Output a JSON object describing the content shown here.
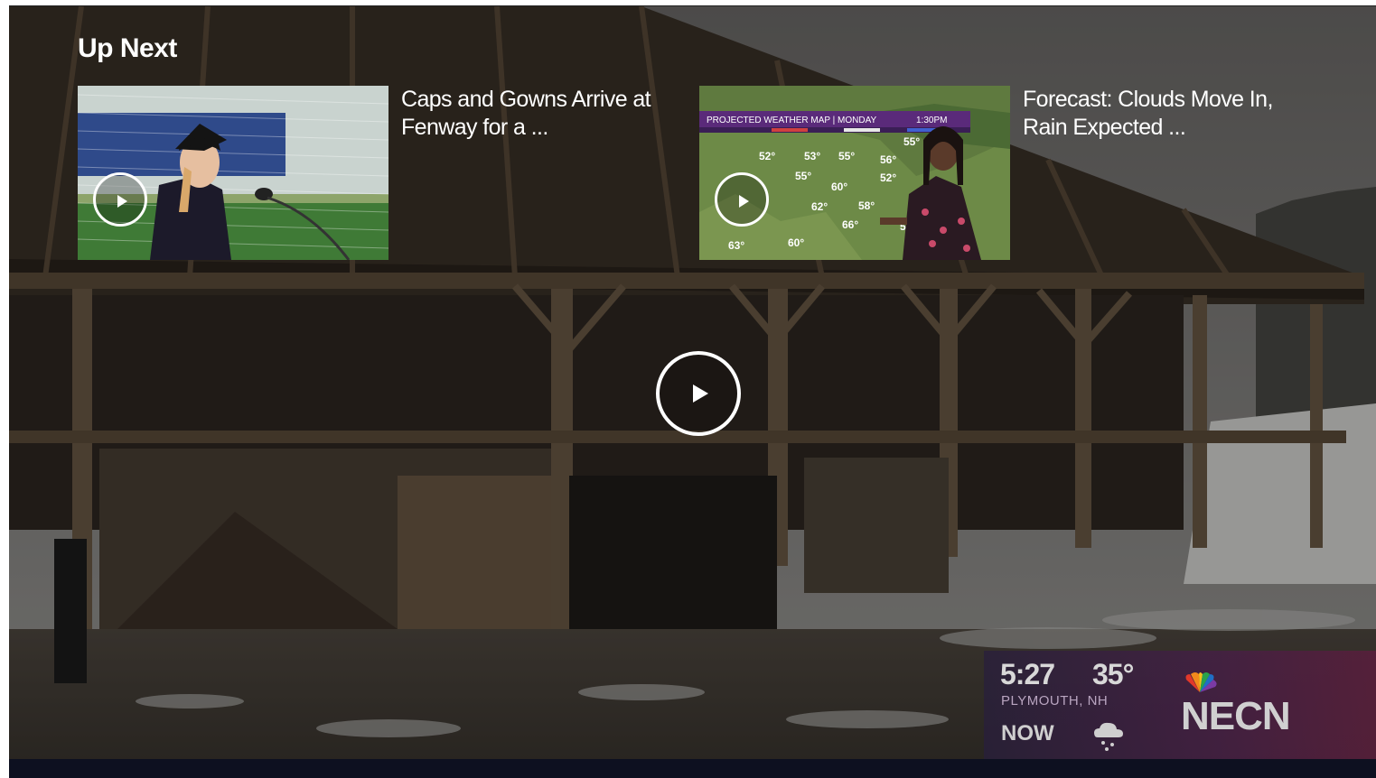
{
  "up_next": {
    "heading": "Up Next",
    "items": [
      {
        "title": "Caps and Gowns Arrive at Fenway for a ...",
        "thumbnail": "graduation-speaker-thumbnail"
      },
      {
        "title": "Forecast: Clouds Move In, Rain Expected ...",
        "thumbnail": "weather-map-thumbnail",
        "map_header": "PROJECTED WEATHER MAP | MONDAY",
        "map_time": "1:30PM",
        "map_temps": [
          "52°",
          "53°",
          "55°",
          "55°",
          "56°",
          "55°",
          "60°",
          "52°",
          "62°",
          "58°",
          "66°",
          "63°",
          "60°",
          "55°"
        ]
      }
    ]
  },
  "player": {
    "main_play_icon": "play-icon"
  },
  "weather_bug": {
    "time": "5:27",
    "temperature": "35°",
    "location": "PLYMOUTH, NH",
    "now_label": "NOW",
    "condition_icon": "snow-cloud-icon",
    "brand": "NECN"
  }
}
